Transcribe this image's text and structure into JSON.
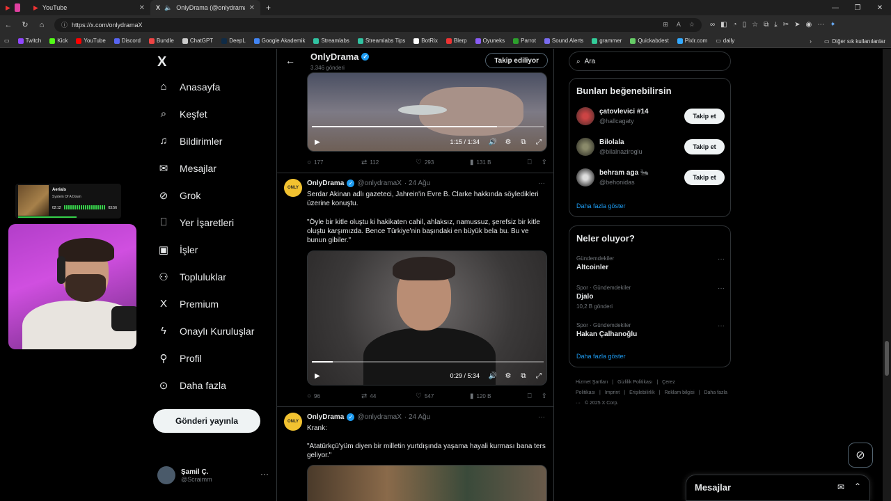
{
  "browser": {
    "tabs": [
      {
        "title": "YouTube",
        "icon": "youtube-icon"
      },
      {
        "title": "OnlyDrama (@onlydramaX) / X",
        "icon": "x-logo-icon"
      }
    ],
    "url": "https://x.com/onlydramaX",
    "bookmarks": [
      "Twitch",
      "Kick",
      "YouTube",
      "Discord",
      "Bundle",
      "ChatGPT",
      "DeepL",
      "Google Akademik",
      "Streamlabs",
      "Streamlabs Tips",
      "BotRix",
      "Blerp",
      "Oyuneks",
      "Parrot",
      "Sound Alerts",
      "grammer",
      "Quickabdest",
      "Pixlr.com",
      "daily"
    ],
    "bookmarks_other": "Diğer sık kullanılanlar"
  },
  "nav": {
    "items": [
      {
        "label": "Anasayfa",
        "icon": "home-icon",
        "glyph": "⌂"
      },
      {
        "label": "Keşfet",
        "icon": "search-icon",
        "glyph": "⌕"
      },
      {
        "label": "Bildirimler",
        "icon": "bell-icon",
        "glyph": "♫"
      },
      {
        "label": "Mesajlar",
        "icon": "mail-icon",
        "glyph": "✉"
      },
      {
        "label": "Grok",
        "icon": "grok-icon",
        "glyph": "⊘"
      },
      {
        "label": "Yer İşaretleri",
        "icon": "bookmark-icon",
        "glyph": "⎕"
      },
      {
        "label": "İşler",
        "icon": "briefcase-icon",
        "glyph": "▣"
      },
      {
        "label": "Topluluklar",
        "icon": "communities-icon",
        "glyph": "⚇"
      },
      {
        "label": "Premium",
        "icon": "x-logo-icon",
        "glyph": "X"
      },
      {
        "label": "Onaylı Kuruluşlar",
        "icon": "lightning-icon",
        "glyph": "ϟ"
      },
      {
        "label": "Profil",
        "icon": "person-icon",
        "glyph": "⚲"
      },
      {
        "label": "Daha fazla",
        "icon": "more-circle-icon",
        "glyph": "⊙"
      }
    ],
    "post_button": "Gönderi yayınla",
    "account": {
      "name": "Şamil Ç.",
      "handle": "@Scraimm"
    }
  },
  "profile_header": {
    "name": "OnlyDrama",
    "posts": "3.346 gönderi",
    "follow_button": "Takip ediliyor"
  },
  "tweets": [
    {
      "video_time": "1:15 / 1:34",
      "progress": 0.8,
      "stats": {
        "replies": "177",
        "reposts": "112",
        "likes": "293",
        "views": "131 B"
      }
    },
    {
      "name": "OnlyDrama",
      "handle": "@onlydramaX",
      "date": "· 24 Ağu",
      "text1": "Serdar Akinan adlı gazeteci, Jahrein'in Evre B. Clarke hakkında söyledikleri üzerine konuştu.",
      "text2": "\"Öyle bir kitle oluştu ki hakikaten cahil, ahlaksız, namussuz, şerefsiz bir kitle oluştu karşımızda. Bence Türkiye'nin başındaki en büyük bela bu. Bu ve bunun gibiler.\"",
      "video_time": "0:29 / 5:34",
      "progress": 0.09,
      "stats": {
        "replies": "96",
        "reposts": "44",
        "likes": "547",
        "views": "120 B"
      }
    },
    {
      "name": "OnlyDrama",
      "handle": "@onlydramaX",
      "date": "· 24 Ağu",
      "text1": "Krank:",
      "text2": "\"Atatürkçü'yüm diyen bir milletin yurtdışında yaşama hayali kurması bana ters geliyor.\""
    }
  ],
  "search": {
    "placeholder": "Ara"
  },
  "who_to_follow": {
    "title": "Bunları beğenebilirsin",
    "users": [
      {
        "name": "çatovlevici #14",
        "handle": "@hallcagaty",
        "button": "Takip et"
      },
      {
        "name": "Bilolala",
        "handle": "@bilalnaziroglu",
        "button": "Takip et"
      },
      {
        "name": "behram aga 🐜",
        "handle": "@behonidas",
        "button": "Takip et"
      }
    ],
    "show_more": "Daha fazla göster"
  },
  "trends": {
    "title": "Neler oluyor?",
    "items": [
      {
        "category": "Gündemdekiler",
        "title": "Altcoinler",
        "count": ""
      },
      {
        "category": "Spor · Gündemdekiler",
        "title": "Djalo",
        "count": "10,2 B gönderi"
      },
      {
        "category": "Spor · Gündemdekiler",
        "title": "Hakan Çalhanoğlu",
        "count": ""
      }
    ],
    "show_more": "Daha fazla göster"
  },
  "footer": {
    "links": [
      "Hizmet Şartları",
      "|",
      "Gizlilik Politikası",
      "|",
      "Çerez Politikası",
      "|",
      "Imprint",
      "|",
      "Erişilebilirlik",
      "|",
      "Reklam bilgisi",
      "|",
      "Daha fazla ···",
      "© 2025 X Corp."
    ]
  },
  "messages_drawer": {
    "title": "Mesajlar"
  },
  "stream_overlay": {
    "song": "Aerials",
    "artist": "System Of A Down",
    "elapsed": "02:12",
    "duration": "03:56"
  },
  "colors": {
    "accent": "#1d9bf0",
    "background": "#000000",
    "border": "#2f3336"
  }
}
